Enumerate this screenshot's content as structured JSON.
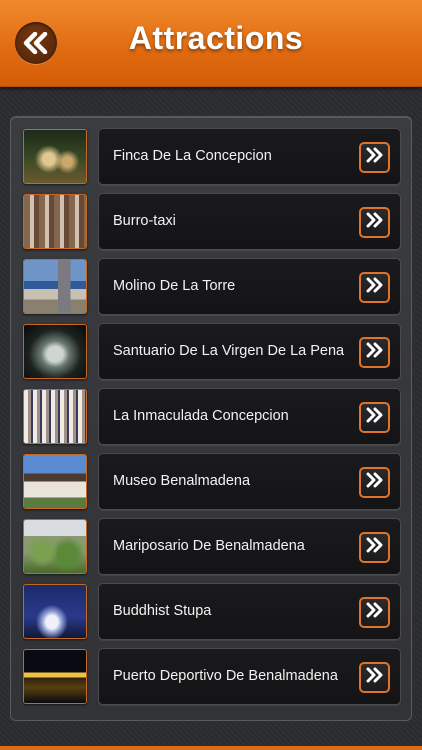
{
  "header": {
    "title": "Attractions",
    "back_icon": "double-chevron-left-icon"
  },
  "colors": {
    "header_orange": "#e8781e",
    "button_border": "#e0752a",
    "background": "#2d2e31"
  },
  "items": [
    {
      "label": "Finca De La Concepcion",
      "thumbnail": "garden-at-night"
    },
    {
      "label": "Burro-taxi",
      "thumbnail": "donkeys-in-street"
    },
    {
      "label": "Molino De La Torre",
      "thumbnail": "coastal-town"
    },
    {
      "label": "Santuario De La Virgen De La Pena",
      "thumbnail": "cave-shrine"
    },
    {
      "label": "La Inmaculada Concepcion",
      "thumbnail": "church-interior"
    },
    {
      "label": "Museo Benalmadena",
      "thumbnail": "museum-building"
    },
    {
      "label": "Mariposario De Benalmadena",
      "thumbnail": "butterfly-house"
    },
    {
      "label": "Buddhist Stupa",
      "thumbnail": "stupa-at-dusk"
    },
    {
      "label": "Puerto Deportivo De Benalmadena",
      "thumbnail": "marina-at-night"
    }
  ],
  "row_action_icon": "double-chevron-right-icon"
}
